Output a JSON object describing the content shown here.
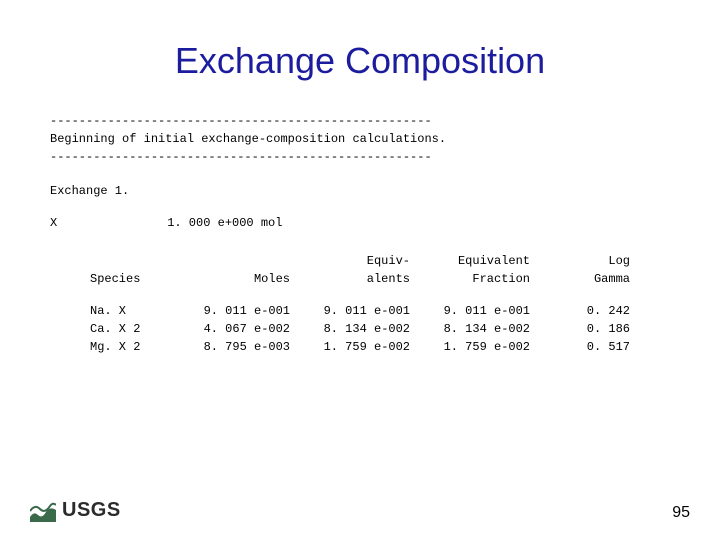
{
  "title": "Exchange Composition",
  "rule": "-----------------------------------------------------",
  "beginning": "Beginning of initial exchange-composition calculations.",
  "exchange_label": "Exchange 1.",
  "x_label": "X",
  "x_value": "1. 000 e+000 mol",
  "headers": {
    "species": "Species",
    "moles": "Moles",
    "equiv1": "Equiv-",
    "equiv2": "alents",
    "frac1": "Equivalent",
    "frac2": "Fraction",
    "log1": "Log",
    "log2": "Gamma"
  },
  "rows": [
    {
      "species": "Na. X",
      "moles": "9. 011 e-001",
      "equiv": "9. 011 e-001",
      "frac": "9. 011 e-001",
      "log": "0. 242"
    },
    {
      "species": "Ca. X 2",
      "moles": "4. 067 e-002",
      "equiv": "8. 134 e-002",
      "frac": "8. 134 e-002",
      "log": "0. 186"
    },
    {
      "species": "Mg. X 2",
      "moles": "8. 795 e-003",
      "equiv": "1. 759 e-002",
      "frac": "1. 759 e-002",
      "log": "0. 517"
    }
  ],
  "logo_text": "USGS",
  "page_number": "95"
}
